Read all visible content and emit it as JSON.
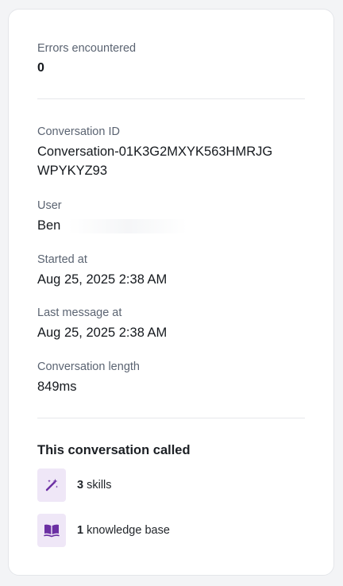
{
  "details": {
    "errors": {
      "label": "Errors encountered",
      "value": "0"
    },
    "conversation_id": {
      "label": "Conversation ID",
      "value": "Conversation-01K3G2MXYK563HMRJGWPYKYZ93"
    },
    "user": {
      "label": "User",
      "value": "Ben"
    },
    "started_at": {
      "label": "Started at",
      "value": "Aug 25, 2025 2:38 AM"
    },
    "last_message_at": {
      "label": "Last message at",
      "value": "Aug 25, 2025 2:38 AM"
    },
    "length": {
      "label": "Conversation length",
      "value": "849ms"
    }
  },
  "called": {
    "title": "This conversation called",
    "items": [
      {
        "icon": "magic-wand-icon",
        "count": "3",
        "label": "skills"
      },
      {
        "icon": "open-book-icon",
        "count": "1",
        "label": "knowledge base"
      }
    ]
  },
  "colors": {
    "icon_bg": "#efe7f7",
    "icon_fg": "#6b2fa3"
  }
}
